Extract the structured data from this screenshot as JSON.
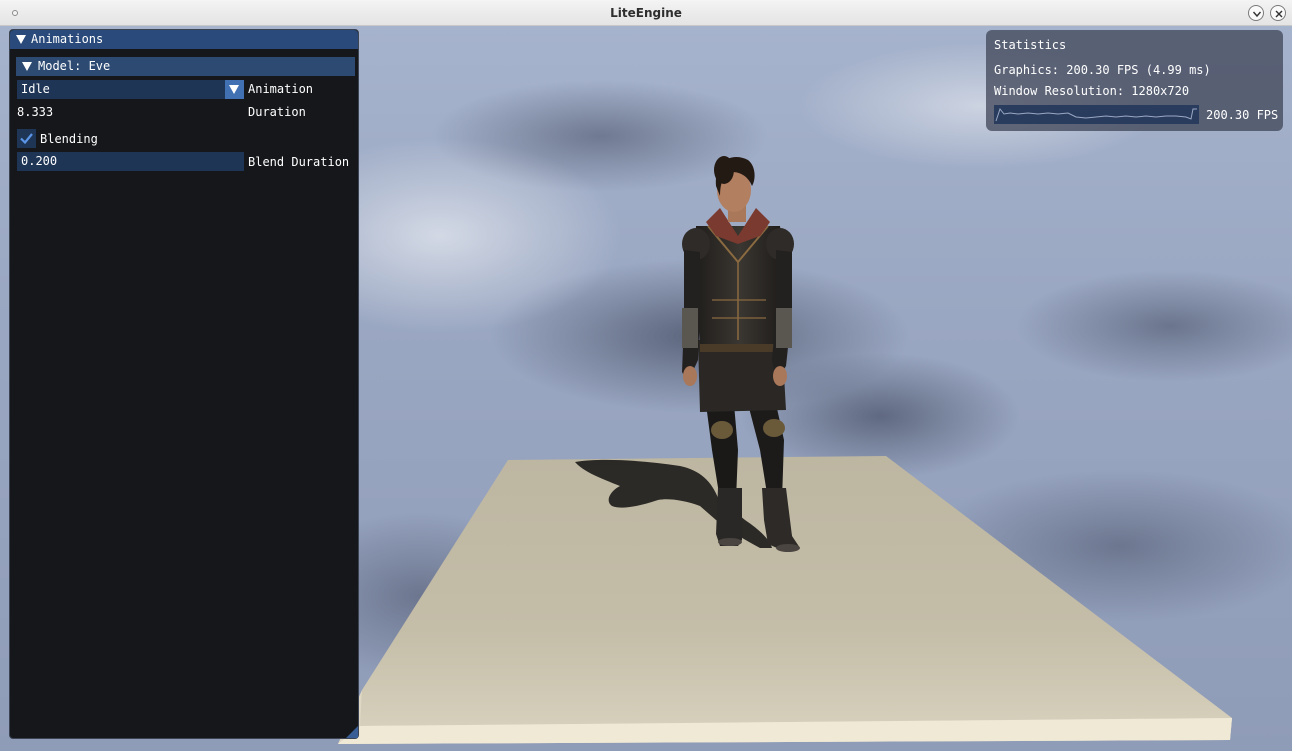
{
  "window": {
    "title": "LiteEngine",
    "minimize_icon": "chevron-down-icon",
    "close_icon": "close-icon"
  },
  "animations_panel": {
    "title": "Animations",
    "model_header": "Model: Eve",
    "animation_value": "Idle",
    "animation_label": "Animation",
    "duration_value": "8.333",
    "duration_label": "Duration",
    "blending_label": "Blending",
    "blending_checked": true,
    "blend_duration_value": "0.200",
    "blend_duration_label": "Blend Duration"
  },
  "statistics": {
    "title": "Statistics",
    "graphics": "Graphics: 200.30 FPS (4.99 ms)",
    "resolution": "Window Resolution: 1280x720",
    "fps_overlay": "200.30 FPS"
  },
  "colors": {
    "panel_bg": "#15171b",
    "header_blue": "#294a7a",
    "frame_blue": "#1f3556",
    "accent_blue": "#4271b3",
    "platform": "#c2bba6"
  }
}
